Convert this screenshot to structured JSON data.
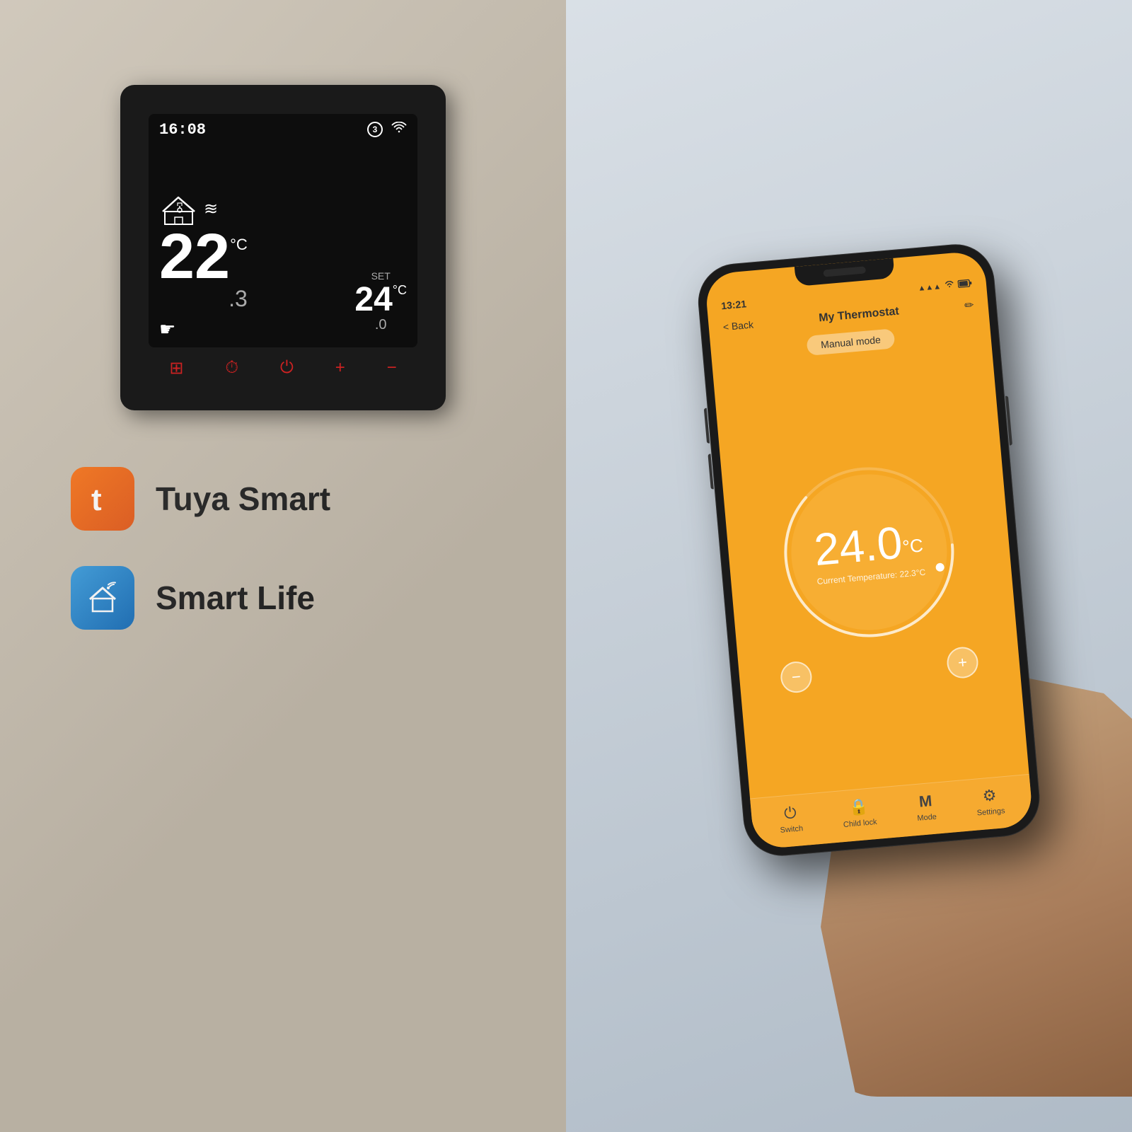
{
  "left": {
    "thermostat": {
      "time": "16:08",
      "circle_num": "3",
      "current_temp": "22",
      "current_temp_decimal": ".3",
      "temp_unit": "°C",
      "set_label": "SET",
      "set_temp": "24",
      "set_temp_decimal": ".0",
      "set_unit": "°C"
    },
    "brands": [
      {
        "name": "Tuya Smart",
        "icon": "tuya",
        "color": "#f97316"
      },
      {
        "name": "Smart Life",
        "icon": "smartlife",
        "color": "#3b9edf"
      }
    ]
  },
  "phone": {
    "status_bar": {
      "time": "13:21",
      "battery": "●●●",
      "signal": "▲▲▲"
    },
    "header": {
      "back_label": "< Back",
      "title": "My Thermostat"
    },
    "mode_badge": "Manual mode",
    "temperature": {
      "set_value": "24.0",
      "unit": "°C",
      "current_label": "Current Temperature: 22.3°C"
    },
    "controls": {
      "minus": "−",
      "plus": "+"
    },
    "bottom_nav": [
      {
        "icon": "⏻",
        "label": "Switch"
      },
      {
        "icon": "🔒",
        "label": "Child lock"
      },
      {
        "icon": "M",
        "label": "Mode"
      },
      {
        "icon": "⚙",
        "label": "Settings"
      }
    ]
  }
}
